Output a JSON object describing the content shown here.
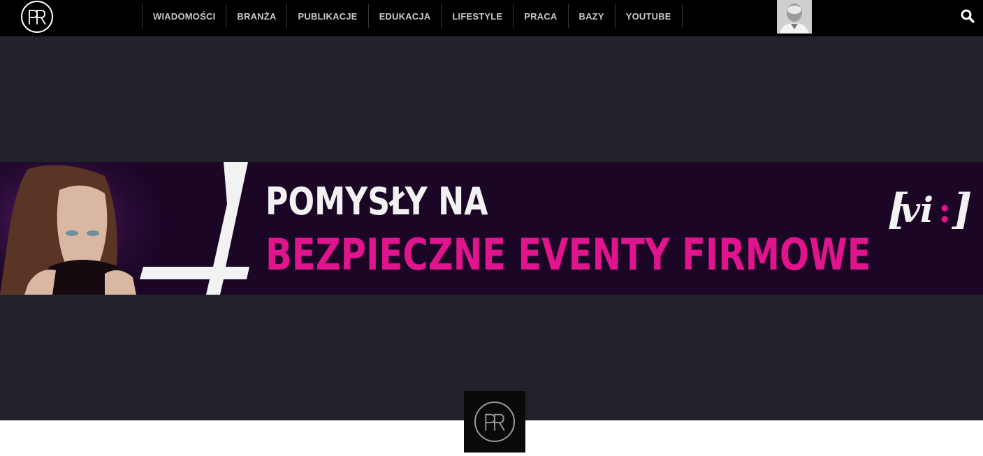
{
  "header": {
    "logo_icon": "pr-logo-icon",
    "nav": [
      {
        "label": "WIADOMOŚCI"
      },
      {
        "label": "BRANŻA"
      },
      {
        "label": "PUBLIKACJE"
      },
      {
        "label": "EDUKACJA"
      },
      {
        "label": "LIFESTYLE"
      },
      {
        "label": "PRACA"
      },
      {
        "label": "BAZY"
      },
      {
        "label": "YOUTUBE"
      }
    ],
    "search_icon": "search-icon",
    "avatar_icon": "user-avatar"
  },
  "banner": {
    "number": "4",
    "title_line1": "POMYSŁY NA",
    "title_line2": "BEZPIECZNE EVENTY FIRMOWE",
    "brand": "[vi:]",
    "colors": {
      "background": "#1b0626",
      "title_line1": "#f2f2f2",
      "title_line2": "#e0148c",
      "brand_colon": "#e0148c"
    }
  },
  "footer": {
    "logo_icon": "pr-logo-icon"
  },
  "colors": {
    "topbar": "#000000",
    "main": "#22232a",
    "nav_text": "#c9c9c9"
  }
}
